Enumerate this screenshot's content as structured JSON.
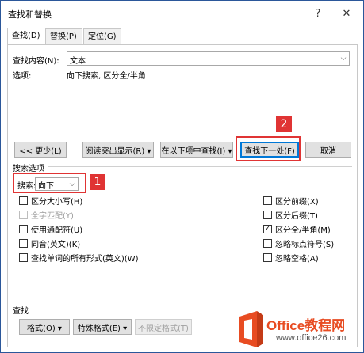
{
  "window": {
    "title": "查找和替换",
    "help": "?",
    "close": "✕"
  },
  "tabs": [
    {
      "label": "查找(D)",
      "active": true
    },
    {
      "label": "替换(P)",
      "active": false
    },
    {
      "label": "定位(G)",
      "active": false
    }
  ],
  "find": {
    "label": "查找内容(N):",
    "value": "文本"
  },
  "options_row": {
    "label": "选项:",
    "value": "向下搜索, 区分全/半角"
  },
  "buttons": {
    "less": "<< 更少(L)",
    "reading_highlight": "阅读突出显示(R) ▾",
    "find_in": "在以下项中查找(I) ▾",
    "find_next": "查找下一处(F)",
    "cancel": "取消"
  },
  "search_options": {
    "section_label": "搜索选项",
    "search_label": "搜索:",
    "search_value": "向下"
  },
  "left_options": [
    {
      "label": "区分大小写(H)",
      "checked": false,
      "disabled": false
    },
    {
      "label": "全字匹配(Y)",
      "checked": false,
      "disabled": true
    },
    {
      "label": "使用通配符(U)",
      "checked": false,
      "disabled": false
    },
    {
      "label": "同音(英文)(K)",
      "checked": false,
      "disabled": false
    },
    {
      "label": "查找单词的所有形式(英文)(W)",
      "checked": false,
      "disabled": false
    }
  ],
  "right_options": [
    {
      "label": "区分前缀(X)",
      "checked": false
    },
    {
      "label": "区分后缀(T)",
      "checked": false
    },
    {
      "label": "区分全/半角(M)",
      "checked": true
    },
    {
      "label": "忽略标点符号(S)",
      "checked": false
    },
    {
      "label": "忽略空格(A)",
      "checked": false
    }
  ],
  "find_section": {
    "label": "查找",
    "format": "格式(O) ▾",
    "special": "特殊格式(E) ▾",
    "no_format": "不限定格式(T)"
  },
  "annotations": {
    "badge1": "1",
    "badge2": "2",
    "accent": "#e03434"
  },
  "watermark": {
    "brand": "Office教程网",
    "url": "www.office26.com"
  }
}
